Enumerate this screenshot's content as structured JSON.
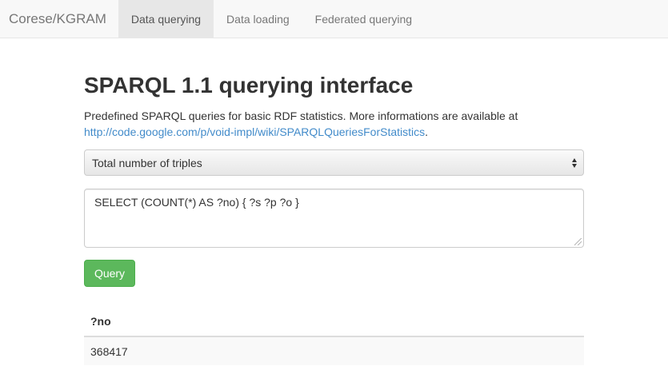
{
  "navbar": {
    "brand": "Corese/KGRAM",
    "items": [
      {
        "label": "Data querying",
        "active": true
      },
      {
        "label": "Data loading",
        "active": false
      },
      {
        "label": "Federated querying",
        "active": false
      }
    ]
  },
  "main": {
    "title": "SPARQL 1.1 querying interface",
    "description_text": "Predefined SPARQL queries for basic RDF statistics. More informations are available at",
    "description_link": "http://code.google.com/p/void-impl/wiki/SPARQLQueriesForStatistics",
    "description_suffix": ".",
    "select": {
      "selected": "Total number of triples"
    },
    "query_text": "SELECT (COUNT(*) AS ?no) { ?s ?p ?o  }",
    "query_button": "Query",
    "results": {
      "columns": [
        "?no"
      ],
      "rows": [
        [
          "368417"
        ]
      ]
    }
  },
  "colors": {
    "navbar_bg": "#f8f8f8",
    "nav_active_bg": "#e7e7e7",
    "link": "#428bca",
    "button_success": "#5cb85c",
    "table_stripe": "#f9f9f9"
  }
}
